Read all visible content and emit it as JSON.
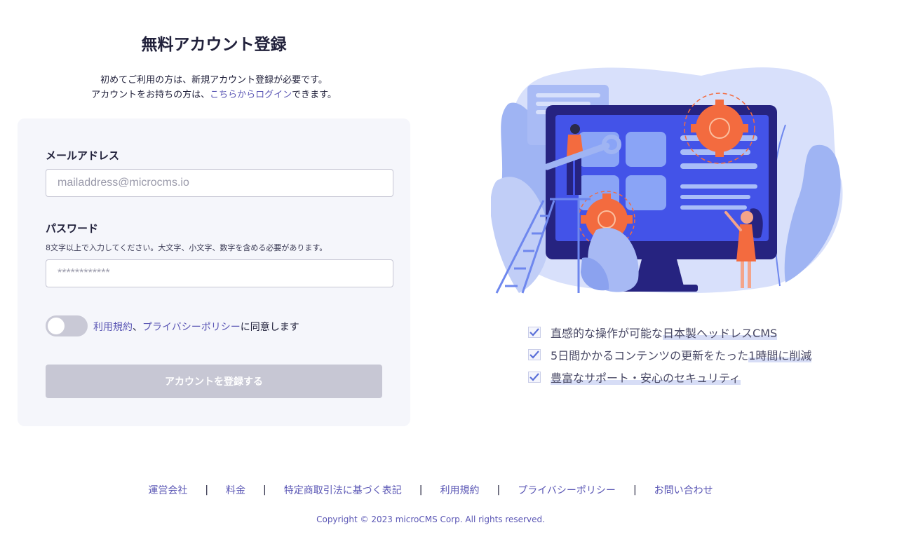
{
  "page": {
    "title": "無料アカウント登録",
    "intro_line1": "初めてご利用の方は、新規アカウント登録が必要です。",
    "intro_line2_prefix": "アカウントをお持ちの方は、",
    "intro_login_link": "こちらからログイン",
    "intro_line2_suffix": "できます。"
  },
  "form": {
    "email_label": "メールアドレス",
    "email_placeholder": "mailaddress@microcms.io",
    "email_value": "",
    "password_label": "パスワード",
    "password_hint": "8文字以上で入力してください。大文字、小文字、数字を含める必要があります。",
    "password_placeholder": "************",
    "password_value": "",
    "agree_terms_link": "利用規約",
    "agree_separator": "、",
    "agree_privacy_link": "プライバシーポリシー",
    "agree_suffix": "に同意します",
    "agree_toggle_on": false,
    "submit_label": "アカウントを登録する"
  },
  "features": [
    {
      "plain": "直感的な操作が可能な",
      "highlight": "日本製ヘッドレスCMS"
    },
    {
      "plain": "5日間かかるコンテンツの更新をたった",
      "highlight": "1時間に削減"
    },
    {
      "plain": "",
      "highlight": "豊富なサポート・安心のセキュリティ"
    }
  ],
  "footer": {
    "links": [
      "運営会社",
      "料金",
      "特定商取引法に基づく表記",
      "利用規約",
      "プライバシーポリシー",
      "お問い合わせ"
    ],
    "separator": "|",
    "copyright": "Copyright © 2023 microCMS Corp. All rights reserved."
  },
  "colors": {
    "link": "#5b57b5",
    "text": "#21213b",
    "form_bg": "#f5f6fb",
    "button_disabled": "#c7c7d4",
    "accent_orange": "#f36b3f",
    "accent_indigo": "#4353e8",
    "check": "#5a6fd8"
  },
  "icons": {
    "feature_check": "check-icon"
  }
}
